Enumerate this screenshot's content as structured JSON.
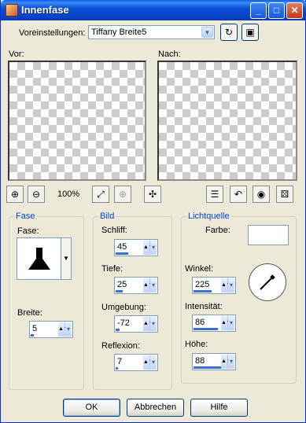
{
  "window": {
    "title": "Innenfase"
  },
  "presets": {
    "label": "Voreinstellungen:",
    "value": "Tiffany Breite5"
  },
  "preview": {
    "before_label": "Vor:",
    "after_label": "Nach:",
    "zoom": "100%"
  },
  "bevel_group": {
    "title": "Fase",
    "shape_label": "Fase:",
    "width_label": "Breite:",
    "width_value": "5",
    "width_fraction": 0.1
  },
  "image_group": {
    "title": "Bild",
    "smoothness_label": "Schliff:",
    "smoothness_value": "45",
    "smoothness_fraction": 0.45,
    "depth_label": "Tiefe:",
    "depth_value": "25",
    "depth_fraction": 0.25,
    "ambience_label": "Umgebung:",
    "ambience_value": "-72",
    "ambience_fraction": 0.14,
    "shininess_label": "Reflexion:",
    "shininess_value": "7",
    "shininess_fraction": 0.07
  },
  "light_group": {
    "title": "Lichtquelle",
    "color_label": "Farbe:",
    "color_value": "#ffffff",
    "angle_label": "Winkel:",
    "angle_value": "225",
    "angle_fraction": 0.625,
    "intensity_label": "Intensität:",
    "intensity_value": "86",
    "intensity_fraction": 0.86,
    "elevation_label": "Höhe:",
    "elevation_value": "88",
    "elevation_fraction": 0.98
  },
  "buttons": {
    "ok": "OK",
    "cancel": "Abbrechen",
    "help": "Hilfe"
  },
  "icons": [
    "app-icon",
    "minimize-icon",
    "maximize-icon",
    "close-icon",
    "randomize-icon",
    "save-icon",
    "zoom-in-icon",
    "zoom-out-icon",
    "fit-window-icon",
    "zoom-disabled-icon",
    "pan-icon",
    "settings-panel-icon",
    "reset-icon",
    "eye-icon",
    "dice-icon"
  ]
}
